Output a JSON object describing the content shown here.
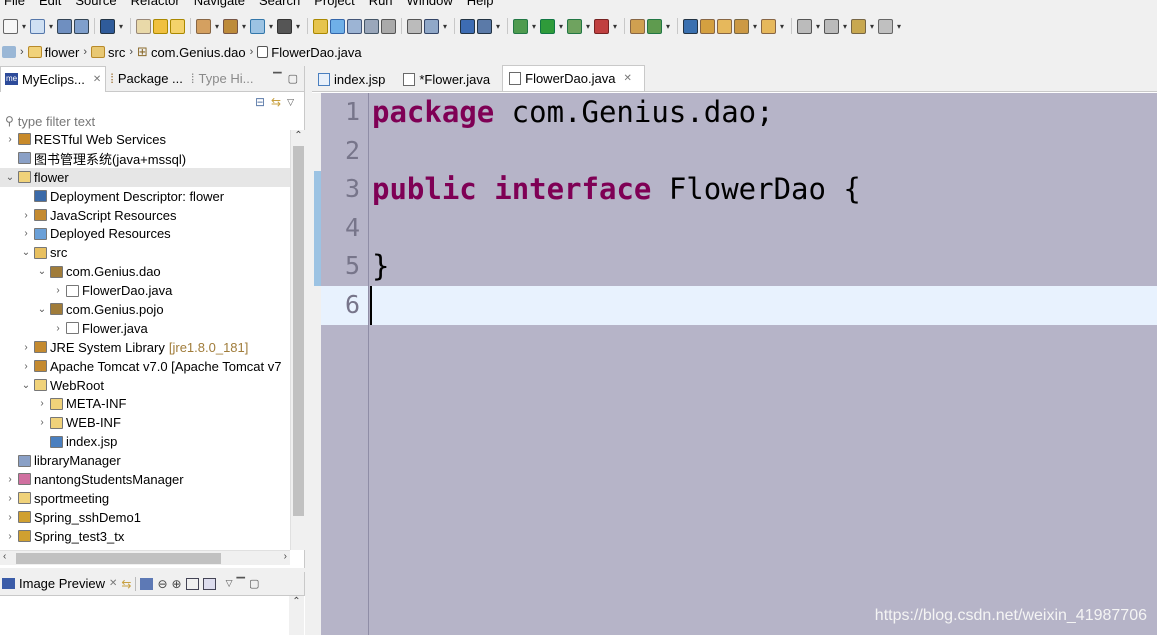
{
  "menu": [
    "File",
    "Edit",
    "Source",
    "Refactor",
    "Navigate",
    "Search",
    "Project",
    "Run",
    "Window",
    "Help"
  ],
  "breadcrumb": {
    "items": [
      "flower",
      "src",
      "com.Genius.dao",
      "FlowerDao.java"
    ]
  },
  "left_panel": {
    "tabs": [
      {
        "label": "MyEclips...",
        "close": "✕"
      },
      {
        "label": "Package ..."
      },
      {
        "label": "Type Hi..."
      }
    ],
    "filter_placeholder": "type filter text",
    "tree": [
      {
        "label": "RESTful Web Services",
        "depth": 0,
        "twisty": "›"
      },
      {
        "label": "图书管理系统(java+mssql)",
        "depth": 0,
        "twisty": ""
      },
      {
        "label": "flower",
        "depth": 0,
        "twisty": "⌄",
        "selected": true
      },
      {
        "label": "Deployment Descriptor: flower",
        "depth": 1,
        "twisty": ""
      },
      {
        "label": "JavaScript Resources",
        "depth": 1,
        "twisty": "›"
      },
      {
        "label": "Deployed Resources",
        "depth": 1,
        "twisty": "›"
      },
      {
        "label": "src",
        "depth": 1,
        "twisty": "⌄"
      },
      {
        "label": "com.Genius.dao",
        "depth": 2,
        "twisty": "⌄"
      },
      {
        "label": "FlowerDao.java",
        "depth": 3,
        "twisty": "›"
      },
      {
        "label": "com.Genius.pojo",
        "depth": 2,
        "twisty": "⌄"
      },
      {
        "label": "Flower.java",
        "depth": 3,
        "twisty": "›"
      },
      {
        "label": "JRE System Library",
        "decoration": "[jre1.8.0_181]",
        "depth": 1,
        "twisty": "›"
      },
      {
        "label": "Apache Tomcat v7.0 [Apache Tomcat v7",
        "depth": 1,
        "twisty": "›"
      },
      {
        "label": "WebRoot",
        "depth": 1,
        "twisty": "⌄"
      },
      {
        "label": "META-INF",
        "depth": 2,
        "twisty": "›"
      },
      {
        "label": "WEB-INF",
        "depth": 2,
        "twisty": "›"
      },
      {
        "label": "index.jsp",
        "depth": 2,
        "twisty": ""
      },
      {
        "label": "libraryManager",
        "depth": 0,
        "twisty": ""
      },
      {
        "label": "nantongStudentsManager",
        "depth": 0,
        "twisty": "›"
      },
      {
        "label": "sportmeeting",
        "depth": 0,
        "twisty": "›"
      },
      {
        "label": "Spring_sshDemo1",
        "depth": 0,
        "twisty": "›"
      },
      {
        "label": "Spring_test3_tx",
        "depth": 0,
        "twisty": "›"
      }
    ]
  },
  "preview_panel": {
    "title": "Image Preview",
    "close": "✕"
  },
  "editor": {
    "tabs": [
      {
        "label": "index.jsp",
        "active": false
      },
      {
        "label": "*Flower.java",
        "active": false
      },
      {
        "label": "FlowerDao.java",
        "active": true,
        "close": "✕"
      }
    ],
    "line_numbers": [
      "1",
      "2",
      "3",
      "4",
      "5",
      "6"
    ],
    "current_line": 6
  },
  "watermark": "https://blog.csdn.net/weixin_41987706",
  "colors": {
    "keyword": "#7f0055",
    "editor_bg": "#b6b4c8",
    "current_line": "#e8f2fe"
  }
}
